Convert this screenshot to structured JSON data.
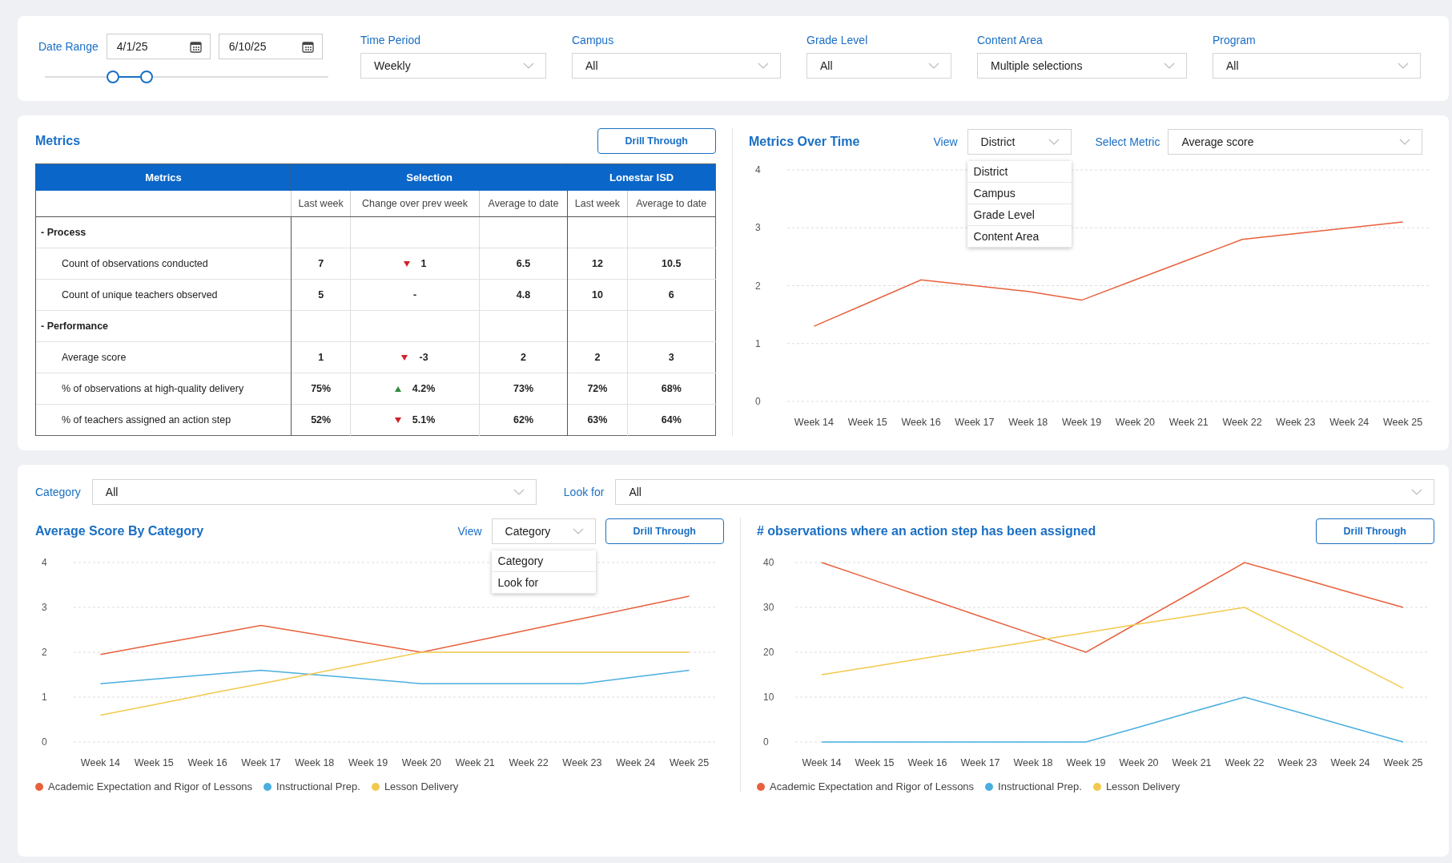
{
  "filters": {
    "date_range": {
      "label": "Date Range",
      "start": "4/1/25",
      "end": "6/10/25",
      "thumbs": [
        {
          "level": 0.24
        },
        {
          "level": 0.36
        }
      ]
    },
    "dropdowns": [
      {
        "label": "Time Period",
        "value": "Weekly"
      },
      {
        "label": "Campus",
        "value": "All"
      },
      {
        "label": "Grade Level",
        "value": "All"
      },
      {
        "label": "Content Area",
        "value": "Multiple selections"
      },
      {
        "label": "Program",
        "value": "All"
      }
    ]
  },
  "metrics": {
    "title": "Metrics",
    "button": "Drill Through",
    "header": {
      "metrics": "Metrics",
      "groups": [
        {
          "label": "Selection",
          "columns": [
            "Last week",
            "Change over prev week",
            "Average to date"
          ]
        },
        {
          "label": "Lonestar ISD",
          "columns": [
            "Last week",
            "Average to date"
          ]
        }
      ]
    },
    "rows": [
      {
        "kind": "section",
        "label": "- Process"
      },
      {
        "kind": "metric",
        "label": "Count of observations conducted",
        "last_week": "7",
        "change": {
          "kind": "down",
          "text": "1"
        },
        "average_to_date": "6.5",
        "isd_last_week": "12",
        "isd_average_to_date": "10.5"
      },
      {
        "kind": "metric",
        "label": "Count of unique teachers observed",
        "last_week": "5",
        "change": {
          "kind": "none",
          "text": "-"
        },
        "average_to_date": "4.8",
        "isd_last_week": "10",
        "isd_average_to_date": "6"
      },
      {
        "kind": "section",
        "label": "- Performance"
      },
      {
        "kind": "metric",
        "label": "Average score",
        "last_week": "1",
        "change": {
          "kind": "down",
          "text": "-3"
        },
        "average_to_date": "2",
        "isd_last_week": "2",
        "isd_average_to_date": "3"
      },
      {
        "kind": "metric",
        "label": "% of observations at high-quality delivery",
        "last_week": "75%",
        "change": {
          "kind": "up",
          "text": "4.2%"
        },
        "average_to_date": "73%",
        "isd_last_week": "72%",
        "isd_average_to_date": "68%"
      },
      {
        "kind": "metric",
        "label": "% of teachers assigned an action step",
        "last_week": "52%",
        "change": {
          "kind": "down",
          "text": "5.1%"
        },
        "average_to_date": "62%",
        "isd_last_week": "63%",
        "isd_average_to_date": "64%"
      }
    ]
  },
  "metrics_over_time": {
    "title": "Metrics Over Time",
    "view": {
      "label": "View",
      "value": "District",
      "expanded": true,
      "options": [
        "District",
        "Campus",
        "Grade Level",
        "Content Area"
      ]
    },
    "select_metric": {
      "label": "Select Metric",
      "value": "Average score"
    },
    "chart_data": {
      "type": "line",
      "categories": [
        "Week 14",
        "Week 15",
        "Week 16",
        "Week 17",
        "Week 18",
        "Week 19",
        "Week 20",
        "Week 21",
        "Week 22",
        "Week 23",
        "Week 24",
        "Week 25"
      ],
      "values": [
        1.3,
        1.7,
        2.1,
        2.0,
        1.9,
        1.75,
        2.1,
        2.45,
        2.8,
        2.9,
        3.0,
        3.1
      ],
      "grid": true,
      "ylim": [
        0,
        4
      ],
      "yticks": [
        0,
        1,
        2,
        3,
        4
      ]
    }
  },
  "bottom_filters": [
    {
      "label": "Category",
      "value": "All"
    },
    {
      "label": "Look for",
      "value": "All"
    }
  ],
  "average_score_by_category": {
    "title": "Average Score By Category",
    "view": {
      "label": "View",
      "value": "Category",
      "expanded": true,
      "options": [
        "Category",
        "Look for"
      ]
    },
    "button": "Drill Through",
    "chart_data": {
      "type": "line",
      "categories": [
        "Week 14",
        "Week 15",
        "Week 16",
        "Week 17",
        "Week 18",
        "Week 19",
        "Week 20",
        "Week 21",
        "Week 22",
        "Week 23",
        "Week 24",
        "Week 25"
      ],
      "series": [
        {
          "name": "Academic Expectation and Rigor of Lessons",
          "color": "#e8603c",
          "values": [
            1.95,
            2.17,
            2.38,
            2.6,
            2.4,
            2.2,
            2.0,
            2.25,
            2.5,
            2.75,
            3.0,
            3.25
          ]
        },
        {
          "name": "Instructional Prep.",
          "color": "#4aaee0",
          "values": [
            1.3,
            1.4,
            1.5,
            1.6,
            1.5,
            1.4,
            1.3,
            1.3,
            1.3,
            1.3,
            1.45,
            1.6
          ]
        },
        {
          "name": "Lesson Delivery",
          "color": "#f2c94c",
          "values": [
            0.6,
            0.83,
            1.07,
            1.3,
            1.53,
            1.77,
            2.0,
            2.0,
            2.0,
            2.0,
            2.0,
            2.0
          ]
        }
      ],
      "ylim": [
        0,
        4
      ],
      "yticks": [
        0,
        1,
        2,
        3,
        4
      ],
      "grid": true
    }
  },
  "action_steps": {
    "title": "# observations where an action step has been assigned",
    "button": "Drill Through",
    "chart_data": {
      "type": "line",
      "categories": [
        "Week 14",
        "Week 15",
        "Week 16",
        "Week 17",
        "Week 18",
        "Week 19",
        "Week 20",
        "Week 21",
        "Week 22",
        "Week 23",
        "Week 24",
        "Week 25"
      ],
      "series": [
        {
          "name": "Academic Expectation and Rigor of Lessons",
          "color": "#e8603c",
          "values": [
            40,
            36,
            32,
            28,
            24,
            20,
            26.7,
            33.3,
            40,
            36.7,
            33.3,
            30
          ]
        },
        {
          "name": "Instructional Prep.",
          "color": "#4aaee0",
          "values": [
            0,
            0,
            0,
            0,
            0,
            0,
            3.3,
            6.7,
            10,
            6.7,
            3.3,
            0
          ]
        },
        {
          "name": "Lesson Delivery",
          "color": "#f2c94c",
          "values": [
            15,
            16.9,
            18.8,
            20.6,
            22.5,
            24.4,
            26.3,
            28.1,
            30,
            24,
            18,
            12
          ]
        }
      ],
      "ylim": [
        0,
        40
      ],
      "yticks": [
        0,
        10,
        20,
        30,
        40
      ],
      "grid": true
    }
  }
}
